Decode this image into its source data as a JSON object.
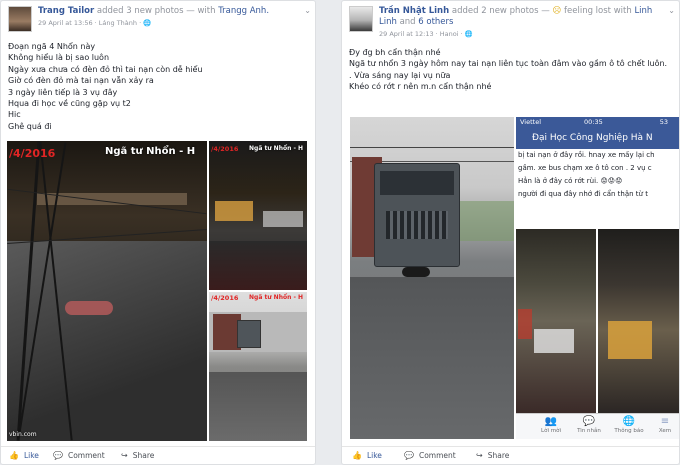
{
  "posts": [
    {
      "author": "Trang Tailor",
      "action": "added 3 new photos",
      "with_prefix": "— with",
      "tagged": "Trangg Anh.",
      "time": "29 April at 13:56",
      "location": "Láng Thành",
      "icon_names": [
        "avatar",
        "globe-icon",
        "chevron-down-icon"
      ],
      "lines": [
        "Đoạn ngã 4 Nhổn này",
        "Không hiểu là bị sao luôn",
        "Ngày xưa chưa có đèn đỏ thì tai nạn còn dễ hiểu",
        "Giờ có đèn đỏ mà tai nạn vẫn xảy ra",
        "3 ngày liên tiếp là 3 vụ đây",
        "Hqua đi học về cũng gặp vụ t2",
        "Hic",
        "Ghê quá đi"
      ],
      "photo_texts": {
        "main_date": "/4/2016",
        "main_caption": "Ngã tư Nhổn - H",
        "main_footer": "vbin.com",
        "small1_date": "/4/2016",
        "small1_caption": "Ngã tư Nhổn - H",
        "small2_date": "/4/2016",
        "small2_caption": "Ngã tư Nhổn - H"
      },
      "actions": {
        "like": "Like",
        "comment": "Comment",
        "share": "Share"
      }
    },
    {
      "author": "Trần Nhật Linh",
      "action": "added 2 new photos",
      "feeling_prefix": "—",
      "feeling": "feeling lost with",
      "tagged": "Linh Linh",
      "and_text": "and",
      "others": "6 others",
      "time": "29 April at 12:13",
      "location": "Hanoi",
      "icon_names": [
        "avatar",
        "sad-face-icon",
        "globe-icon",
        "chevron-down-icon"
      ],
      "lines": [
        "Đy đg bh cẩn thận nhé",
        "Ngã tư nhổn 3 ngày hôm nay tai nạn liên tục toàn đâm vào gầm ô tô chết luôn.",
        ". Vừa sáng nay lại vụ nữa",
        "Khéo có rớt r nên m.n cẩn thận nhé"
      ],
      "phone": {
        "carrier": "Viettel",
        "time": "00:35",
        "battery": "53",
        "title": "Đại Học Công Nghiệp Hà N",
        "text_lines": [
          "bị tai nạn ở đây rồi. hnay xe mấy lại ch",
          "gầm. xe bus chạm xe ô tô con . 2 vụ c",
          "Hẳn là ở đây có rớt rùi. 😟😟😟",
          "người đi qua đây nhớ đi cẩn thận từ t"
        ],
        "nav": [
          "Lời mời",
          "Tin nhắn",
          "Thông báo",
          "Xem"
        ]
      },
      "actions": {
        "like": "Like",
        "comment": "Comment",
        "share": "Share"
      }
    }
  ],
  "colors": {
    "link": "#365899",
    "meta": "#90949c",
    "brand": "#3b5998",
    "overlay_red": "#e02525"
  }
}
